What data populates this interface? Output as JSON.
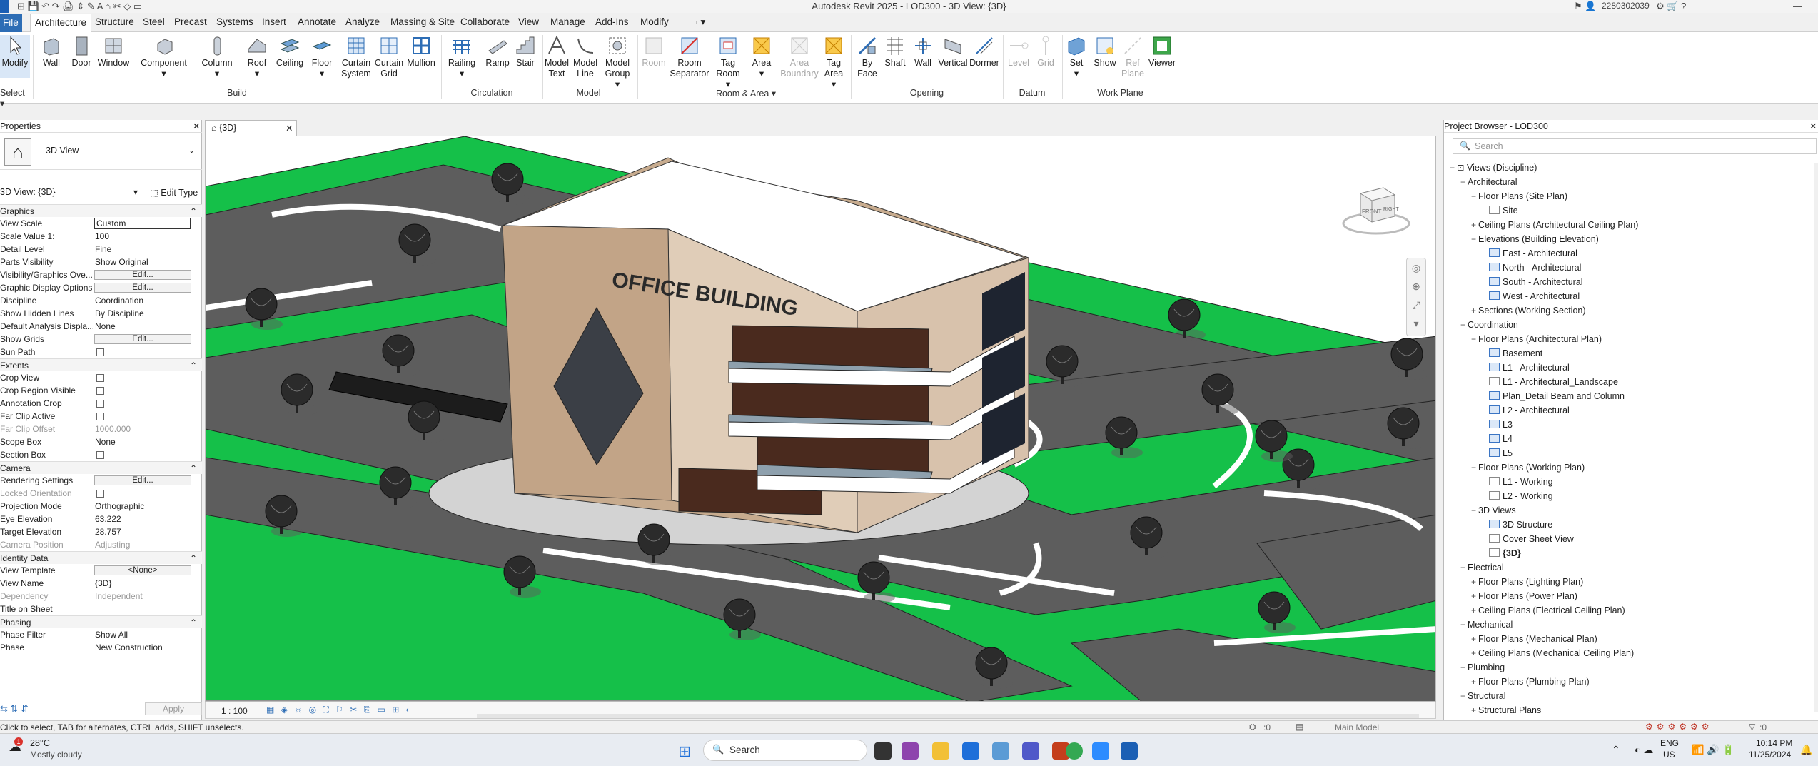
{
  "window": {
    "title": "Autodesk Revit 2025 - LOD300 - 3D View: {3D}",
    "user": "2280302039"
  },
  "tabs": [
    "File",
    "Architecture",
    "Structure",
    "Steel",
    "Precast",
    "Systems",
    "Insert",
    "Annotate",
    "Analyze",
    "Massing & Site",
    "Collaborate",
    "View",
    "Manage",
    "Add-Ins",
    "Modify"
  ],
  "ribbon": {
    "modify": "Modify",
    "select": "Select",
    "build": {
      "label": "Build",
      "tools": [
        "Wall",
        "Door",
        "Window",
        "Component",
        "Column",
        "Roof",
        "Ceiling",
        "Floor",
        "Curtain System",
        "Curtain Grid",
        "Mullion"
      ]
    },
    "circulation": {
      "label": "Circulation",
      "tools": [
        "Railing",
        "Ramp",
        "Stair"
      ]
    },
    "model": {
      "label": "Model",
      "tools": [
        "Model Text",
        "Model Line",
        "Model Group"
      ]
    },
    "room_area": {
      "label": "Room & Area",
      "tools": [
        "Room",
        "Room Separator",
        "Tag Room",
        "Area",
        "Area Boundary",
        "Tag Area"
      ]
    },
    "opening": {
      "label": "Opening",
      "tools": [
        "By Face",
        "Shaft",
        "Wall",
        "Vertical",
        "Dormer"
      ]
    },
    "datum": {
      "label": "Datum",
      "tools": [
        "Level",
        "Grid"
      ]
    },
    "work_plane": {
      "label": "Work Plane",
      "tools": [
        "Set",
        "Show",
        "Ref Plane",
        "Viewer"
      ]
    }
  },
  "properties": {
    "header": "Properties",
    "type": "3D View",
    "selector": "3D View: {3D}",
    "edit_type": "Edit Type",
    "sections": {
      "graphics": "Graphics",
      "extents": "Extents",
      "camera": "Camera",
      "identity": "Identity Data",
      "phasing": "Phasing"
    },
    "graphics_rows": [
      {
        "k": "View Scale",
        "v": "Custom"
      },
      {
        "k": "Scale Value    1:",
        "v": "100"
      },
      {
        "k": "Detail Level",
        "v": "Fine"
      },
      {
        "k": "Parts Visibility",
        "v": "Show Original"
      },
      {
        "k": "Visibility/Graphics Ove...",
        "v": "Edit..."
      },
      {
        "k": "Graphic Display Options",
        "v": "Edit..."
      },
      {
        "k": "Discipline",
        "v": "Coordination"
      },
      {
        "k": "Show Hidden Lines",
        "v": "By Discipline"
      },
      {
        "k": "Default Analysis Displa...",
        "v": "None"
      },
      {
        "k": "Show Grids",
        "v": "Edit..."
      },
      {
        "k": "Sun Path",
        "v": ""
      }
    ],
    "extents_rows": [
      {
        "k": "Crop View",
        "v": ""
      },
      {
        "k": "Crop Region Visible",
        "v": ""
      },
      {
        "k": "Annotation Crop",
        "v": ""
      },
      {
        "k": "Far Clip Active",
        "v": ""
      },
      {
        "k": "Far Clip Offset",
        "v": "1000.000"
      },
      {
        "k": "Scope Box",
        "v": "None"
      },
      {
        "k": "Section Box",
        "v": ""
      }
    ],
    "camera_rows": [
      {
        "k": "Rendering Settings",
        "v": "Edit..."
      },
      {
        "k": "Locked Orientation",
        "v": ""
      },
      {
        "k": "Projection Mode",
        "v": "Orthographic"
      },
      {
        "k": "Eye Elevation",
        "v": "63.222"
      },
      {
        "k": "Target Elevation",
        "v": "28.757"
      },
      {
        "k": "Camera Position",
        "v": "Adjusting"
      }
    ],
    "identity_rows": [
      {
        "k": "View Template",
        "v": "<None>"
      },
      {
        "k": "View Name",
        "v": "{3D}"
      },
      {
        "k": "Dependency",
        "v": "Independent"
      },
      {
        "k": "Title on Sheet",
        "v": ""
      }
    ],
    "phasing_rows": [
      {
        "k": "Phase Filter",
        "v": "Show All"
      },
      {
        "k": "Phase",
        "v": "New Construction"
      }
    ],
    "apply": "Apply"
  },
  "view": {
    "tab": "{3D}",
    "scale": "1 : 100",
    "sign": "OFFICE BUILDING",
    "cube_front": "FRONT",
    "cube_right": "RIGHT"
  },
  "browser": {
    "header": "Project Browser - LOD300",
    "search_placeholder": "Search",
    "items": [
      {
        "t": "Views (Discipline)",
        "lvl": 0,
        "pm": "−"
      },
      {
        "t": "Architectural",
        "lvl": 1,
        "pm": "−"
      },
      {
        "t": "Floor Plans (Site Plan)",
        "lvl": 2,
        "pm": "−"
      },
      {
        "t": "Site",
        "lvl": 3,
        "pm": "",
        "ic": "w"
      },
      {
        "t": "Ceiling Plans (Architectural Ceiling Plan)",
        "lvl": 2,
        "pm": "+"
      },
      {
        "t": "Elevations (Building Elevation)",
        "lvl": 2,
        "pm": "−"
      },
      {
        "t": "East - Architectural",
        "lvl": 3,
        "pm": "",
        "ic": "b"
      },
      {
        "t": "North - Architectural",
        "lvl": 3,
        "pm": "",
        "ic": "b"
      },
      {
        "t": "South - Architectural",
        "lvl": 3,
        "pm": "",
        "ic": "b"
      },
      {
        "t": "West - Architectural",
        "lvl": 3,
        "pm": "",
        "ic": "b"
      },
      {
        "t": "Sections (Working Section)",
        "lvl": 2,
        "pm": "+"
      },
      {
        "t": "Coordination",
        "lvl": 1,
        "pm": "−"
      },
      {
        "t": "Floor Plans (Architectural Plan)",
        "lvl": 2,
        "pm": "−"
      },
      {
        "t": "Basement",
        "lvl": 3,
        "pm": "",
        "ic": "b"
      },
      {
        "t": "L1 - Architectural",
        "lvl": 3,
        "pm": "",
        "ic": "b"
      },
      {
        "t": "L1 - Architectural_Landscape",
        "lvl": 3,
        "pm": "",
        "ic": "w"
      },
      {
        "t": "Plan_Detail Beam and Column",
        "lvl": 3,
        "pm": "",
        "ic": "b"
      },
      {
        "t": "L2 - Architectural",
        "lvl": 3,
        "pm": "",
        "ic": "b"
      },
      {
        "t": "L3",
        "lvl": 3,
        "pm": "",
        "ic": "b"
      },
      {
        "t": "L4",
        "lvl": 3,
        "pm": "",
        "ic": "b"
      },
      {
        "t": "L5",
        "lvl": 3,
        "pm": "",
        "ic": "b"
      },
      {
        "t": "Floor Plans (Working Plan)",
        "lvl": 2,
        "pm": "−"
      },
      {
        "t": "L1 - Working",
        "lvl": 3,
        "pm": "",
        "ic": "w"
      },
      {
        "t": "L2 - Working",
        "lvl": 3,
        "pm": "",
        "ic": "w"
      },
      {
        "t": "3D Views",
        "lvl": 2,
        "pm": "−"
      },
      {
        "t": "3D Structure",
        "lvl": 3,
        "pm": "",
        "ic": "b"
      },
      {
        "t": "Cover Sheet View",
        "lvl": 3,
        "pm": "",
        "ic": "w"
      },
      {
        "t": "{3D}",
        "lvl": 3,
        "pm": "",
        "ic": "w",
        "bold": true
      },
      {
        "t": "Electrical",
        "lvl": 1,
        "pm": "−"
      },
      {
        "t": "Floor Plans (Lighting Plan)",
        "lvl": 2,
        "pm": "+"
      },
      {
        "t": "Floor Plans (Power Plan)",
        "lvl": 2,
        "pm": "+"
      },
      {
        "t": "Ceiling Plans (Electrical Ceiling Plan)",
        "lvl": 2,
        "pm": "+"
      },
      {
        "t": "Mechanical",
        "lvl": 1,
        "pm": "−"
      },
      {
        "t": "Floor Plans (Mechanical Plan)",
        "lvl": 2,
        "pm": "+"
      },
      {
        "t": "Ceiling Plans (Mechanical Ceiling Plan)",
        "lvl": 2,
        "pm": "+"
      },
      {
        "t": "Plumbing",
        "lvl": 1,
        "pm": "−"
      },
      {
        "t": "Floor Plans (Plumbing Plan)",
        "lvl": 2,
        "pm": "+"
      },
      {
        "t": "Structural",
        "lvl": 1,
        "pm": "−"
      },
      {
        "t": "Structural Plans",
        "lvl": 2,
        "pm": "+"
      }
    ]
  },
  "status": {
    "hint": "Click to select, TAB for alternates, CTRL adds, SHIFT unselects.",
    "model": "Main Model",
    "filter": ":0"
  },
  "taskbar": {
    "weather_temp": "28°C",
    "weather_desc": "Mostly cloudy",
    "search": "Search",
    "lang1": "ENG",
    "lang2": "US",
    "time": "10:14 PM",
    "date": "11/25/2024"
  },
  "colors": {
    "grass": "#15c049",
    "road": "#5d5d5d",
    "wall": "#c7ab8e",
    "file_tab": "#2d6db5"
  }
}
